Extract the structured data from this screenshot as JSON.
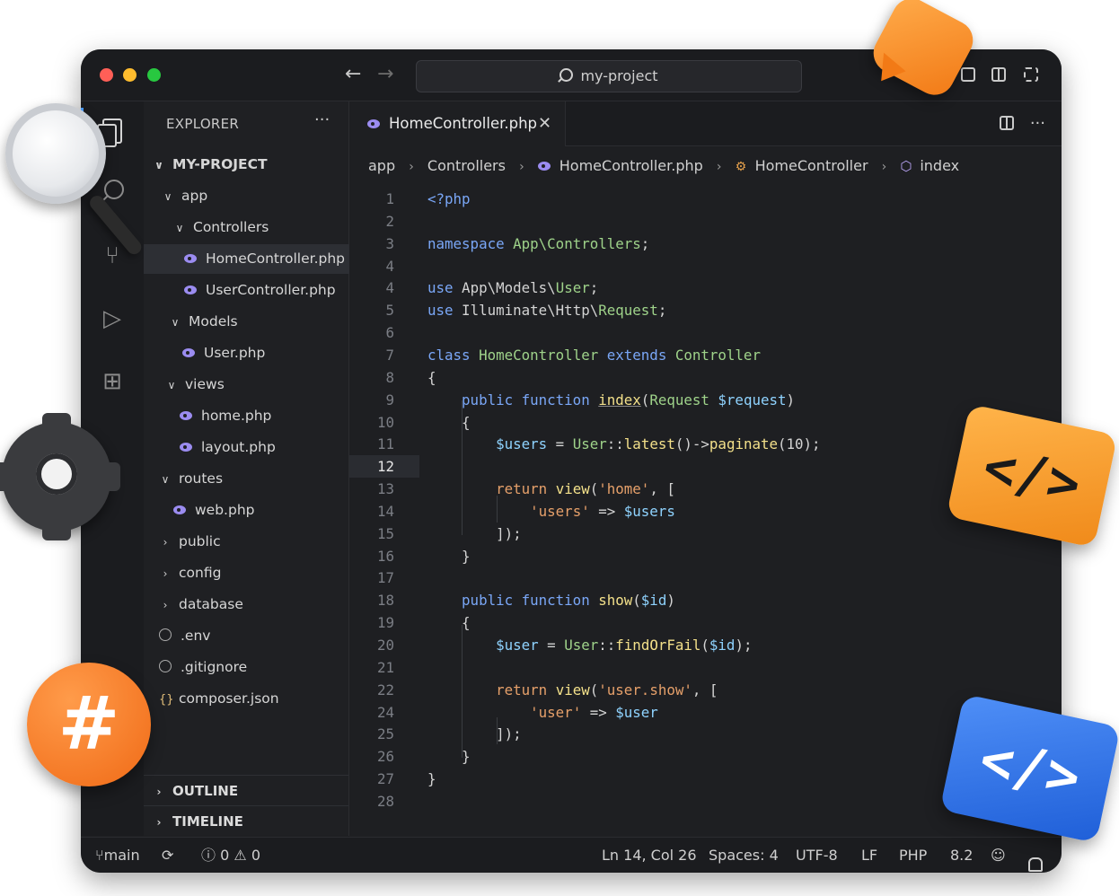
{
  "window": {
    "search_text": "my-project"
  },
  "explorer": {
    "title": "EXPLORER",
    "more": "···",
    "project": "MY-PROJECT",
    "tree": [
      {
        "label": "app",
        "kind": "folder-open"
      },
      {
        "label": "Controllers",
        "kind": "folder-open"
      },
      {
        "label": "HomeController.php",
        "kind": "php",
        "selected": true
      },
      {
        "label": "UserController.php",
        "kind": "php"
      },
      {
        "label": "Models",
        "kind": "folder-open"
      },
      {
        "label": "User.php",
        "kind": "php"
      },
      {
        "label": "views",
        "kind": "folder-open"
      },
      {
        "label": "home.php",
        "kind": "php"
      },
      {
        "label": "layout.php",
        "kind": "php"
      },
      {
        "label": "routes",
        "kind": "folder-open"
      },
      {
        "label": "web.php",
        "kind": "php"
      },
      {
        "label": "public",
        "kind": "folder-closed"
      },
      {
        "label": "config",
        "kind": "folder-closed"
      },
      {
        "label": "database",
        "kind": "folder-closed"
      },
      {
        "label": ".env",
        "kind": "env"
      },
      {
        "label": ".gitignore",
        "kind": "env"
      },
      {
        "label": "composer.json",
        "kind": "json"
      }
    ],
    "outline": "OUTLINE",
    "timeline": "TIMELINE"
  },
  "tab": {
    "label": "HomeController.php",
    "close": "✕",
    "more": "···"
  },
  "breadcrumb": {
    "items": [
      "app",
      "Controllers",
      "HomeController.php",
      "HomeController",
      "index"
    ]
  },
  "code": {
    "current_line": "12",
    "lines": [
      {
        "n": "1",
        "parts": [
          [
            "k",
            "<?php"
          ]
        ]
      },
      {
        "n": "2",
        "parts": []
      },
      {
        "n": "3",
        "parts": [
          [
            "k",
            "namespace"
          ],
          [
            "p",
            " "
          ],
          [
            "t",
            "App\\Controllers"
          ],
          [
            "p",
            ";"
          ]
        ]
      },
      {
        "n": "4",
        "parts": []
      },
      {
        "n": "4",
        "parts": [
          [
            "k",
            "use"
          ],
          [
            "p",
            " App\\Models\\"
          ],
          [
            "t",
            "User"
          ],
          [
            "p",
            ";"
          ]
        ]
      },
      {
        "n": "5",
        "parts": [
          [
            "k",
            "use"
          ],
          [
            "p",
            " Illuminate\\Http\\"
          ],
          [
            "t",
            "Request"
          ],
          [
            "p",
            ";"
          ]
        ]
      },
      {
        "n": "6",
        "parts": []
      },
      {
        "n": "7",
        "parts": [
          [
            "k",
            "class"
          ],
          [
            "p",
            " "
          ],
          [
            "t",
            "HomeController"
          ],
          [
            "p",
            " "
          ],
          [
            "k",
            "extends"
          ],
          [
            "p",
            " "
          ],
          [
            "t",
            "Controller"
          ]
        ]
      },
      {
        "n": "8",
        "parts": [
          [
            "p",
            "{"
          ]
        ]
      },
      {
        "n": "9",
        "parts": [
          [
            "p",
            "    "
          ],
          [
            "k",
            "public function"
          ],
          [
            "p",
            " "
          ],
          [
            "fu",
            "index"
          ],
          [
            "p",
            "("
          ],
          [
            "t",
            "Request"
          ],
          [
            "p",
            " "
          ],
          [
            "v",
            "$request"
          ],
          [
            "p",
            ")"
          ]
        ]
      },
      {
        "n": "10",
        "parts": [
          [
            "p",
            "    {"
          ]
        ]
      },
      {
        "n": "11",
        "parts": [
          [
            "p",
            "        "
          ],
          [
            "v",
            "$users"
          ],
          [
            "p",
            " = "
          ],
          [
            "t",
            "User"
          ],
          [
            "p",
            "::"
          ],
          [
            "f",
            "latest"
          ],
          [
            "p",
            "()->"
          ],
          [
            "f",
            "paginate"
          ],
          [
            "p",
            "(10);"
          ]
        ]
      },
      {
        "n": "12",
        "parts": []
      },
      {
        "n": "13",
        "parts": [
          [
            "p",
            "        "
          ],
          [
            "s",
            "return"
          ],
          [
            "p",
            " "
          ],
          [
            "f",
            "view"
          ],
          [
            "p",
            "("
          ],
          [
            "s",
            "'home'"
          ],
          [
            "p",
            ", ["
          ]
        ]
      },
      {
        "n": "14",
        "parts": [
          [
            "p",
            "            "
          ],
          [
            "s",
            "'users'"
          ],
          [
            "p",
            " => "
          ],
          [
            "v",
            "$users"
          ]
        ]
      },
      {
        "n": "15",
        "parts": [
          [
            "p",
            "        ]);"
          ]
        ]
      },
      {
        "n": "16",
        "parts": [
          [
            "p",
            "    }"
          ]
        ]
      },
      {
        "n": "17",
        "parts": []
      },
      {
        "n": "18",
        "parts": [
          [
            "p",
            "    "
          ],
          [
            "k",
            "public function"
          ],
          [
            "p",
            " "
          ],
          [
            "f",
            "show"
          ],
          [
            "p",
            "("
          ],
          [
            "v",
            "$id"
          ],
          [
            "p",
            ")"
          ]
        ]
      },
      {
        "n": "19",
        "parts": [
          [
            "p",
            "    {"
          ]
        ]
      },
      {
        "n": "20",
        "parts": [
          [
            "p",
            "        "
          ],
          [
            "v",
            "$user"
          ],
          [
            "p",
            " = "
          ],
          [
            "t",
            "User"
          ],
          [
            "p",
            "::"
          ],
          [
            "f",
            "findOrFail"
          ],
          [
            "p",
            "("
          ],
          [
            "v",
            "$id"
          ],
          [
            "p",
            ");"
          ]
        ]
      },
      {
        "n": "21",
        "parts": []
      },
      {
        "n": "22",
        "parts": [
          [
            "p",
            "        "
          ],
          [
            "s",
            "return"
          ],
          [
            "p",
            " "
          ],
          [
            "f",
            "view"
          ],
          [
            "p",
            "("
          ],
          [
            "s",
            "'user.show'"
          ],
          [
            "p",
            ", ["
          ]
        ]
      },
      {
        "n": "24",
        "parts": [
          [
            "p",
            "            "
          ],
          [
            "s",
            "'user'"
          ],
          [
            "p",
            " => "
          ],
          [
            "v",
            "$user"
          ]
        ]
      },
      {
        "n": "25",
        "parts": [
          [
            "p",
            "        ]);"
          ]
        ]
      },
      {
        "n": "26",
        "parts": [
          [
            "p",
            "    }"
          ]
        ]
      },
      {
        "n": "27",
        "parts": [
          [
            "p",
            "}"
          ]
        ]
      },
      {
        "n": "28",
        "parts": []
      }
    ]
  },
  "statusbar": {
    "branch": "main",
    "errors": "0",
    "warnings": "0",
    "position": "Ln 14, Col 26",
    "spaces": "Spaces: 4",
    "encoding": "UTF-8",
    "eol": "LF",
    "language": "PHP",
    "version": "8.2"
  },
  "decor": {
    "hash_symbol": "#",
    "code_symbol": "</>"
  },
  "colors": {
    "keyword": "#7aa7f7",
    "type": "#9fd38a",
    "function": "#f3e08a",
    "variable": "#8fd3ff",
    "string": "#e6a06a",
    "accent": "#4a9eff"
  }
}
